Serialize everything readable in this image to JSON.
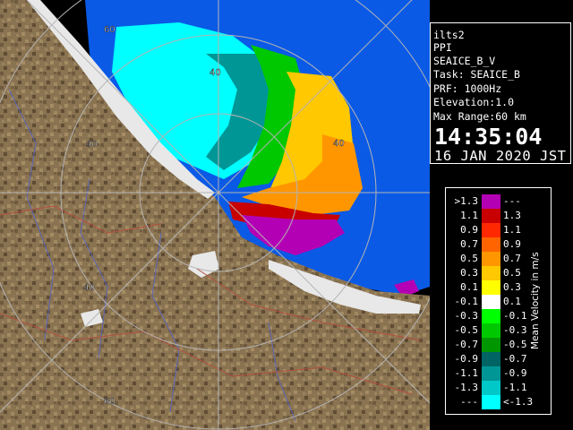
{
  "radar": {
    "range_labels": [
      "60",
      "40",
      "40",
      "40",
      "40",
      "60"
    ]
  },
  "info": {
    "site": "ilts2",
    "product": "PPI",
    "volume": "SEAICE_B_V",
    "task": "Task: SEAICE_B",
    "prf": "PRF: 1000Hz",
    "elevation": "Elevation:1.0",
    "max_range": "Max Range:60 km",
    "time": "14:35:04",
    "date": "16 JAN 2020 JST"
  },
  "legend": {
    "title": "Mean Velocity in m/s",
    "rows": [
      {
        "left": ">1.3",
        "right": "---",
        "color": "#b400b4"
      },
      {
        "left": "1.1",
        "right": "1.3",
        "color": "#c80000"
      },
      {
        "left": "0.9",
        "right": "1.1",
        "color": "#ff2800"
      },
      {
        "left": "0.7",
        "right": "0.9",
        "color": "#ff6400"
      },
      {
        "left": "0.5",
        "right": "0.7",
        "color": "#ff9600"
      },
      {
        "left": "0.3",
        "right": "0.5",
        "color": "#ffc800"
      },
      {
        "left": "0.1",
        "right": "0.3",
        "color": "#ffff00"
      },
      {
        "left": "-0.1",
        "right": "0.1",
        "color": "#ffffff"
      },
      {
        "left": "-0.3",
        "right": "-0.1",
        "color": "#00ff00"
      },
      {
        "left": "-0.5",
        "right": "-0.3",
        "color": "#00c800"
      },
      {
        "left": "-0.7",
        "right": "-0.5",
        "color": "#009600"
      },
      {
        "left": "-0.9",
        "right": "-0.7",
        "color": "#006464"
      },
      {
        "left": "-1.1",
        "right": "-0.9",
        "color": "#009696"
      },
      {
        "left": "-1.3",
        "right": "-1.1",
        "color": "#00c8c8"
      },
      {
        "left": "---",
        "right": "<-1.3",
        "color": "#00ffff"
      }
    ]
  },
  "colors": {
    "land": "#8a7351",
    "sea": "#0a5ae6",
    "outbound_max": "#b400b4",
    "inbound_max": "#00ffff",
    "range_ring": "#b4b4b4",
    "rivers": "#5a64b4",
    "boundaries": "#b45040"
  }
}
